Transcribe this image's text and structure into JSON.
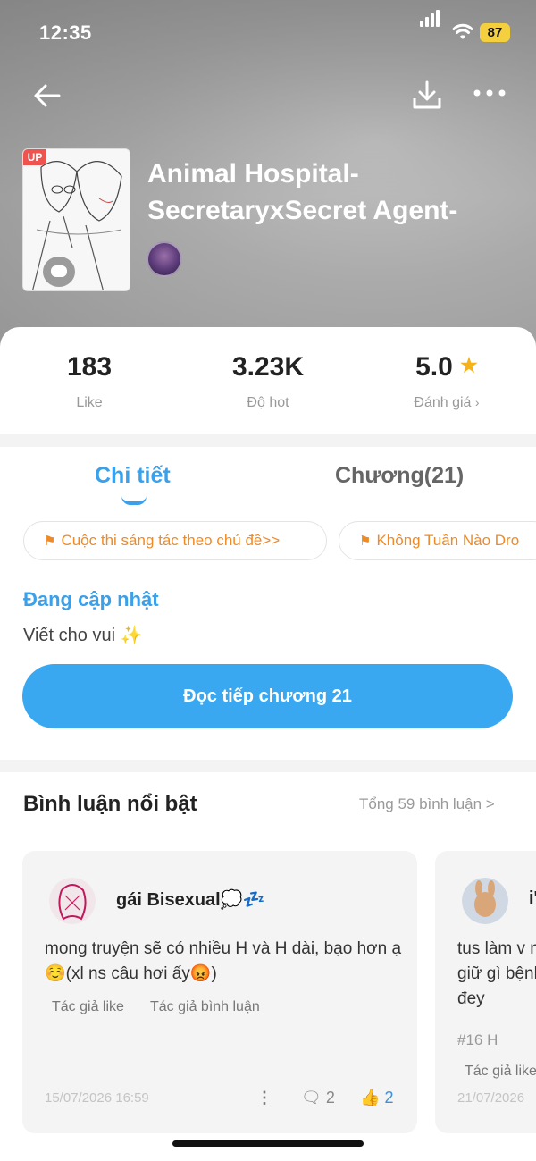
{
  "status_bar": {
    "time": "12:35",
    "battery": "87"
  },
  "book": {
    "title": "Animal Hospital-SecretaryxSecret Agent-",
    "badge": "UP"
  },
  "stats": [
    {
      "value": "183",
      "label": "Like"
    },
    {
      "value": "3.23K",
      "label": "Độ hot"
    },
    {
      "value": "5.0",
      "label": "Đánh giá",
      "suffix": "›"
    }
  ],
  "tabs": [
    {
      "label": "Chi tiết",
      "active": true
    },
    {
      "label": "Chương(21)",
      "active": false
    }
  ],
  "chips": [
    "Cuộc thi sáng tác theo chủ đề>>",
    "Không Tuần Nào Dro"
  ],
  "status_text": "Đang cập nhật",
  "description": "Viết cho vui ✨",
  "read_button": "Đọc tiếp chương 21",
  "comments": {
    "title": "Bình luận nổi bật",
    "total": "Tổng 59 bình luận >",
    "items": [
      {
        "user": "gái Bisexual💭💤",
        "text": "mong truyện sẽ có nhiều H và H dài, bạo hơn ạ☺️(xl ns câu hơi ấy😡)",
        "tags": [
          "Tác giả like",
          "Tác giả bình luận"
        ],
        "date": "15/07/2026 16:59",
        "replies": "2",
        "likes": "2"
      },
      {
        "user": "i'",
        "text": "tus làm v nhớ giữ gì bệnh đey",
        "tag_line": "#16 H",
        "tags": [
          "Tác giả like"
        ],
        "date": "21/07/2026"
      }
    ]
  },
  "colors": {
    "accent": "#3aa0ea",
    "button": "#3aa8f0",
    "chip_text": "#f08a24",
    "star": "#f5b31b"
  }
}
